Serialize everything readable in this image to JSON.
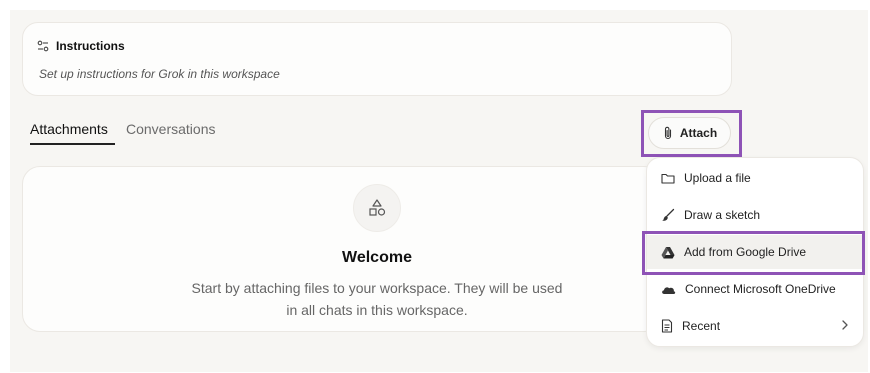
{
  "instructions": {
    "title": "Instructions",
    "subtitle": "Set up instructions for Grok in this workspace"
  },
  "tabs": [
    {
      "label": "Attachments",
      "active": true
    },
    {
      "label": "Conversations",
      "active": false
    }
  ],
  "welcome": {
    "icon": "shapes-icon",
    "title": "Welcome",
    "body_line1": "Start by attaching files to your workspace. They will be used",
    "body_line2": "in all chats in this workspace."
  },
  "attach_button": {
    "label": "Attach",
    "icon": "paperclip-icon"
  },
  "attach_menu": {
    "items": [
      {
        "label": "Upload a file",
        "icon": "folder-icon"
      },
      {
        "label": "Draw a sketch",
        "icon": "brush-icon"
      },
      {
        "label": "Add from Google Drive",
        "icon": "google-drive-icon"
      },
      {
        "label": "Connect Microsoft OneDrive",
        "icon": "onedrive-icon"
      },
      {
        "label": "Recent",
        "icon": "document-icon",
        "has_submenu": true
      }
    ]
  },
  "highlight_color": "#8e53b6"
}
